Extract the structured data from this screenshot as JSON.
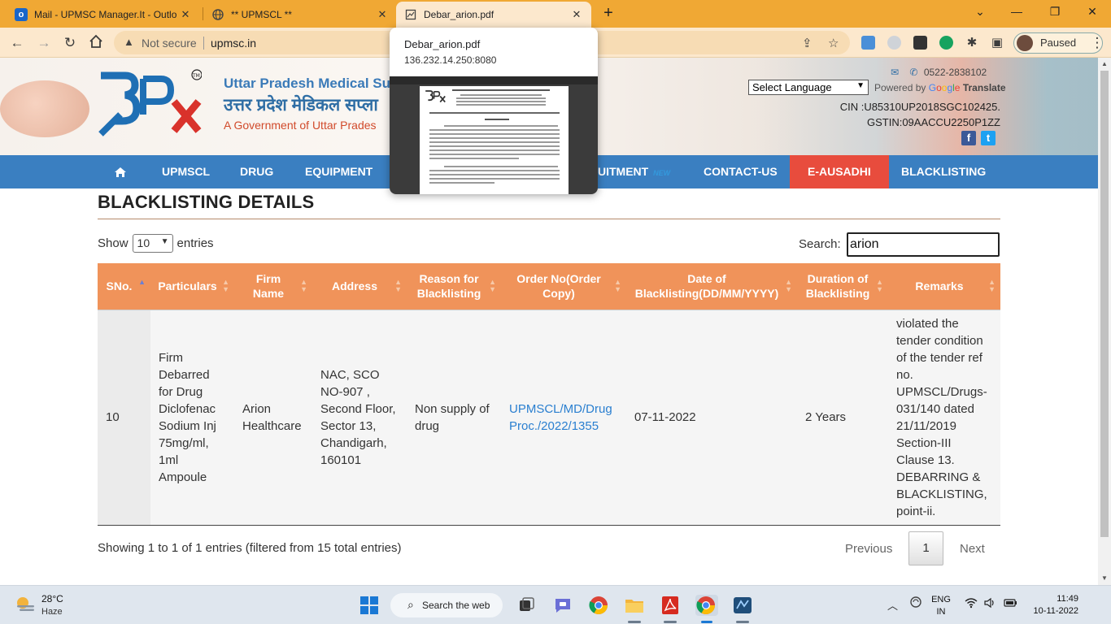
{
  "browser": {
    "tabs": [
      {
        "title": "Mail - UPMSC Manager.It - Outlo",
        "icon": "outlook-icon"
      },
      {
        "title": "** UPMSCL **",
        "icon": "globe-icon"
      },
      {
        "title": "Debar_arion.pdf",
        "icon": "pdf-icon"
      }
    ],
    "omnibox": {
      "security": "Not secure",
      "url": "upmsc.in"
    },
    "profile_label": "Paused"
  },
  "tab_preview": {
    "title": "Debar_arion.pdf",
    "url": "136.232.14.250:8080"
  },
  "site": {
    "title_en": "Uttar Pradesh Medical Su",
    "title_hi": "उत्तर प्रदेश मेडिकल सप्ला",
    "subtitle": "A Government of Uttar Prades",
    "phone": "0522-2838102",
    "language_select": "Select Language",
    "powered_by": "Powered by",
    "google": [
      "G",
      "o",
      "o",
      "g",
      "l",
      "e"
    ],
    "translate": "Translate",
    "cin": "CIN :U85310UP2018SGC102425.",
    "gstin": "GSTIN:09AACCU2250P1ZZ"
  },
  "nav": {
    "items": [
      "UPMSCL",
      "DRUG",
      "EQUIPMENT",
      "UITMENT",
      "CONTACT-US",
      "E-AUSADHI",
      "BLACKLISTING"
    ],
    "new_badge": "NEW"
  },
  "page": {
    "title": "BLACKLISTING DETAILS",
    "show_label": "Show",
    "entries_value": "10",
    "entries_label": "entries",
    "search_label": "Search:",
    "search_value": "arion"
  },
  "table": {
    "columns": [
      "SNo.",
      "Particulars",
      "Firm Name",
      "Address",
      "Reason for Blacklisting",
      "Order No(Order Copy)",
      "Date of Blacklisting(DD/MM/YYYY)",
      "Duration of Blacklisting",
      "Remarks"
    ],
    "rows": [
      {
        "sno": "10",
        "particulars": "Firm Debarred for Drug Diclofenac Sodium Inj 75mg/ml, 1ml Ampoule",
        "firm": "Arion Healthcare",
        "address": "NAC, SCO NO-907 , Second Floor, Sector 13, Chandigarh, 160101",
        "reason": "Non supply of drug",
        "order": "UPMSCL/MD/Drug Proc./2022/1355",
        "date": "07-11-2022",
        "duration": "2 Years",
        "remarks": "violated the tender condition of the tender ref no. UPMSCL/Drugs-031/140 dated 21/11/2019 Section-III Clause 13. DEBARRING & BLACKLISTING, point-ii."
      }
    ]
  },
  "footer": {
    "info": "Showing 1 to 1 of 1 entries (filtered from 15 total entries)",
    "prev": "Previous",
    "current_page": "1",
    "next": "Next"
  },
  "taskbar": {
    "temp": "28°C",
    "weather": "Haze",
    "search": "Search the web",
    "lang_top": "ENG",
    "lang_bottom": "IN",
    "time": "11:49",
    "date": "10-11-2022"
  },
  "colors": {
    "tabstrip": "#f0a834",
    "nav": "#3a7fc1",
    "table_header": "#f0935a",
    "ausadhi": "#e84c3d",
    "link": "#2a7fd0"
  }
}
